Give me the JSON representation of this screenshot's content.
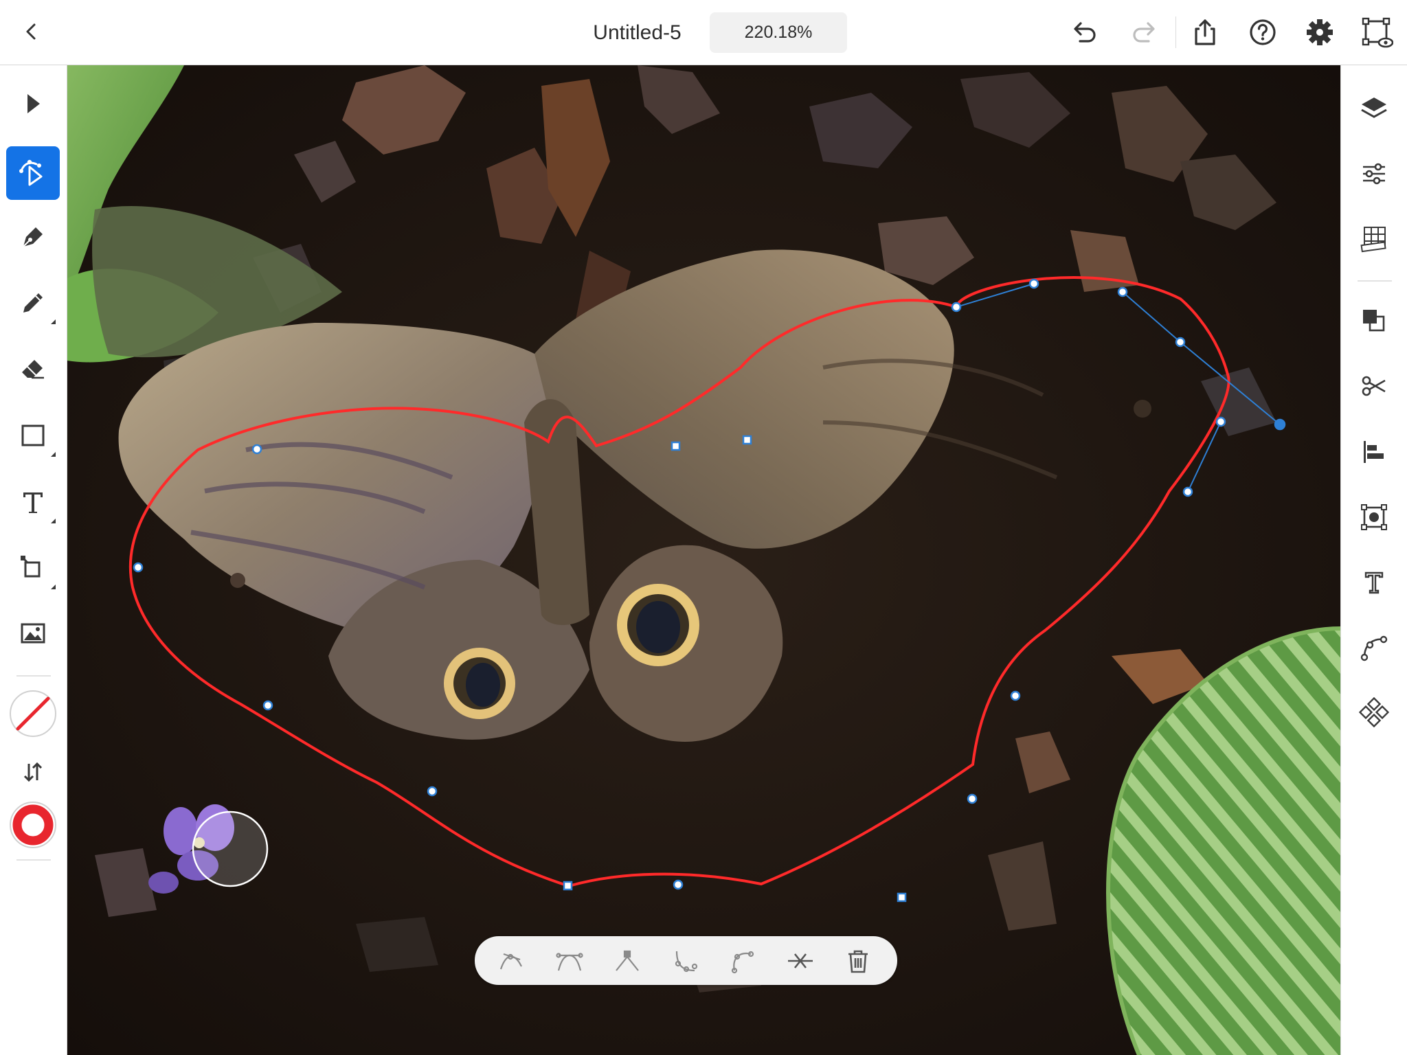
{
  "document": {
    "title": "Untitled-5",
    "zoom": "220.18%"
  },
  "topbar": {
    "icons": [
      "back-icon",
      "undo-icon",
      "redo-icon",
      "share-icon",
      "help-icon",
      "settings-icon",
      "preview-icon"
    ]
  },
  "left_tools": [
    {
      "name": "select-tool",
      "icon": "arrow-icon",
      "active": false
    },
    {
      "name": "direct-select-tool",
      "icon": "direct-select-icon",
      "active": true
    },
    {
      "name": "pen-tool",
      "icon": "pen-icon",
      "active": false
    },
    {
      "name": "pencil-tool",
      "icon": "pencil-icon",
      "active": false
    },
    {
      "name": "eraser-tool",
      "icon": "eraser-icon",
      "active": false
    },
    {
      "name": "shape-tool",
      "icon": "rectangle-icon",
      "active": false
    },
    {
      "name": "type-tool",
      "icon": "type-icon",
      "active": false
    },
    {
      "name": "transform-tool",
      "icon": "transform-icon",
      "active": false
    },
    {
      "name": "place-image-tool",
      "icon": "image-icon",
      "active": false
    }
  ],
  "colors": {
    "accent": "#1473e6",
    "fill": "none",
    "stroke": "#e8262e",
    "path_stroke": "#ff2a2a",
    "anchor": "#2e80d6"
  },
  "right_tools": [
    {
      "name": "layers-panel",
      "icon": "layers-icon"
    },
    {
      "name": "properties-panel",
      "icon": "sliders-icon"
    },
    {
      "name": "grid-panel",
      "icon": "grid-ruler-icon"
    },
    {
      "name": "pathfinder-panel",
      "icon": "pathfinder-icon"
    },
    {
      "name": "cut-panel",
      "icon": "scissors-icon"
    },
    {
      "name": "align-panel",
      "icon": "align-icon"
    },
    {
      "name": "image-trace-panel",
      "icon": "image-trace-icon"
    },
    {
      "name": "type-panel",
      "icon": "type-panel-icon"
    },
    {
      "name": "path-panel",
      "icon": "path-icon"
    },
    {
      "name": "repeat-panel",
      "icon": "repeat-icon"
    }
  ],
  "path_toolbar": [
    {
      "name": "smooth-anchor-button",
      "icon": "smooth-anchor-icon"
    },
    {
      "name": "convert-anchor-button",
      "icon": "convert-anchor-icon"
    },
    {
      "name": "corner-anchor-button",
      "icon": "corner-anchor-icon"
    },
    {
      "name": "add-anchor-button",
      "icon": "add-anchor-icon"
    },
    {
      "name": "curve-anchor-button",
      "icon": "curve-anchor-icon"
    },
    {
      "name": "cut-path-button",
      "icon": "cut-path-icon"
    },
    {
      "name": "delete-anchor-button",
      "icon": "trash-icon"
    }
  ]
}
